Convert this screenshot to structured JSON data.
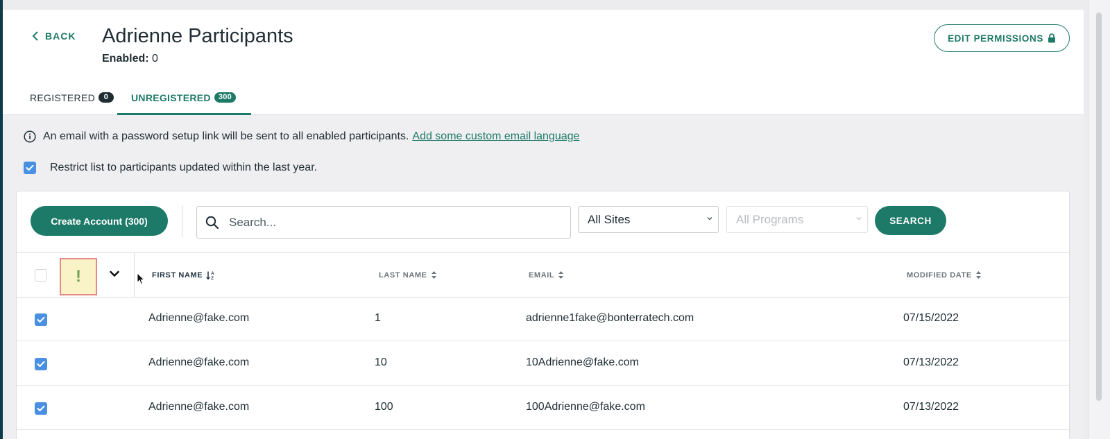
{
  "header": {
    "back_label": "BACK",
    "title": "Adrienne Participants",
    "enabled_label": "Enabled:",
    "enabled_value": "0",
    "edit_permissions_label": "EDIT PERMISSIONS"
  },
  "tabs": [
    {
      "label": "REGISTERED",
      "count": "0",
      "active": false
    },
    {
      "label": "UNREGISTERED",
      "count": "300",
      "active": true
    }
  ],
  "info": {
    "text": "An email with a password setup link will be sent to all enabled participants.",
    "link": "Add some custom email language"
  },
  "restrict": {
    "label": "Restrict list to participants updated within the last year.",
    "checked": true
  },
  "toolbar": {
    "create_label": "Create Account (300)",
    "search_placeholder": "Search...",
    "sites_value": "All Sites",
    "programs_value": "All Programs",
    "search_button": "SEARCH"
  },
  "table": {
    "alert_symbol": "!",
    "columns": {
      "first_name": "FIRST NAME",
      "last_name": "LAST NAME",
      "email": "EMAIL",
      "modified_date": "MODIFIED DATE"
    },
    "rows": [
      {
        "first_name": "Adrienne@fake.com",
        "last_name": "1",
        "email": "adrienne1fake@bonterratech.com",
        "modified": "07/15/2022",
        "checked": true
      },
      {
        "first_name": "Adrienne@fake.com",
        "last_name": "10",
        "email": "10Adrienne@fake.com",
        "modified": "07/13/2022",
        "checked": true
      },
      {
        "first_name": "Adrienne@fake.com",
        "last_name": "100",
        "email": "100Adrienne@fake.com",
        "modified": "07/13/2022",
        "checked": true
      }
    ]
  },
  "colors": {
    "accent": "#1e7a68",
    "checkbox": "#4a90e2",
    "dark": "#1f2d33"
  }
}
